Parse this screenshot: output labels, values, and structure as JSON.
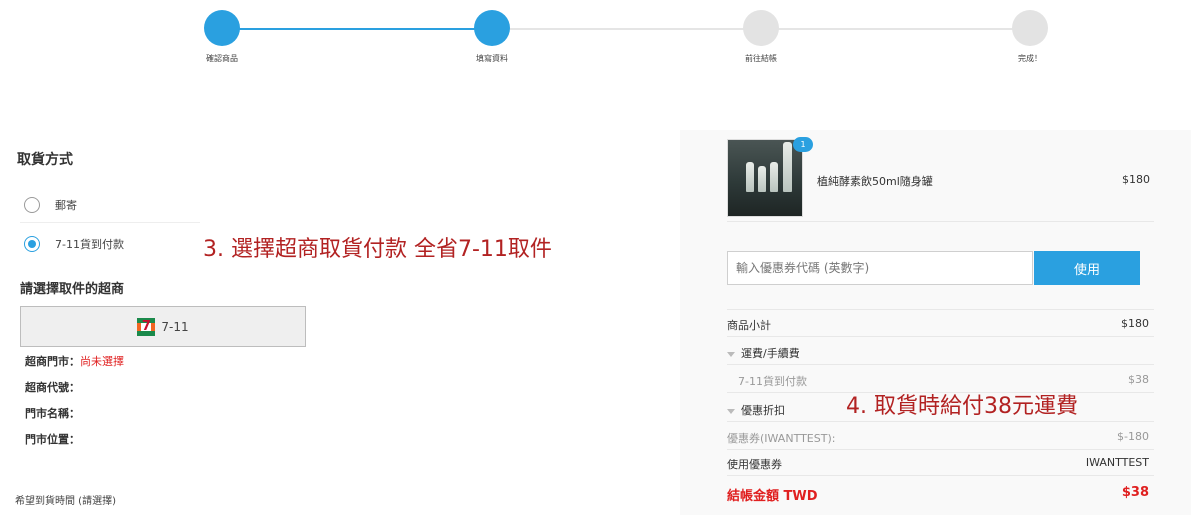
{
  "progress": {
    "steps": [
      {
        "label": "確認商品",
        "done": true
      },
      {
        "label": "填寫資料",
        "done": true
      },
      {
        "label": "前往結帳",
        "done": false
      },
      {
        "label": "完成！",
        "done": false
      }
    ]
  },
  "delivery": {
    "title": "取貨方式",
    "options": [
      {
        "label": "郵寄",
        "checked": false
      },
      {
        "label": "7-11貨到付款",
        "checked": true
      }
    ],
    "annotation": "3. 選擇超商取貨付款 全省7-11取件"
  },
  "store": {
    "title": "請選擇取件的超商",
    "button_label": "7-11",
    "icon": "seven-eleven-logo-icon",
    "fields": [
      {
        "key": "超商門市：",
        "value": "尚未選擇"
      },
      {
        "key": "超商代號：",
        "value": ""
      },
      {
        "key": "門市名稱：",
        "value": ""
      },
      {
        "key": "門市位置：",
        "value": ""
      }
    ]
  },
  "arrival_time_label": "希望到貨時間 (請選擇)",
  "cart": {
    "item": {
      "name": "植純酵素飲50ml隨身罐",
      "price": "$180",
      "quantity": "1"
    }
  },
  "coupon": {
    "placeholder": "輸入優惠券代碼 (英數字)",
    "apply_label": "使用"
  },
  "summary": {
    "subtotal_label": "商品小計",
    "subtotal_value": "$180",
    "shipping_label": "運費/手續費",
    "shipping_method_label": "7-11貨到付款",
    "shipping_method_value": "$38",
    "discount_label": "優惠折扣",
    "coupon_discount_label": "優惠券(IWANTTEST):",
    "coupon_discount_value": "$-180",
    "coupon_used_label": "使用優惠券",
    "coupon_used_value": "IWANTTEST",
    "total_label": "結帳金額 TWD",
    "total_value": "$38",
    "annotation": "4. 取貨時給付38元運費"
  },
  "colors": {
    "accent": "#2aa0e0",
    "inactive": "#e3e3e3",
    "alert": "#e02020",
    "annotation": "#b22222"
  }
}
